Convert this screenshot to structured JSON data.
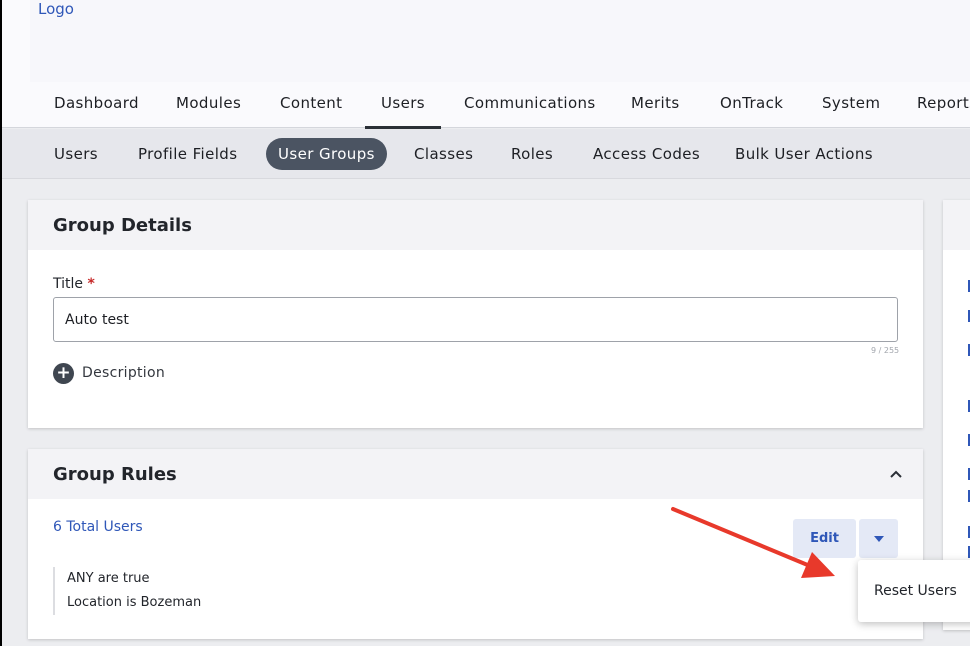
{
  "header": {
    "logo": "Logo"
  },
  "main_nav": {
    "items": [
      {
        "label": "Dashboard"
      },
      {
        "label": "Modules"
      },
      {
        "label": "Content"
      },
      {
        "label": "Users",
        "active": true
      },
      {
        "label": "Communications"
      },
      {
        "label": "Merits"
      },
      {
        "label": "OnTrack"
      },
      {
        "label": "System"
      },
      {
        "label": "Reports"
      }
    ]
  },
  "sub_nav": {
    "items": [
      {
        "label": "Users"
      },
      {
        "label": "Profile Fields"
      },
      {
        "label": "User Groups",
        "active": true
      },
      {
        "label": "Classes"
      },
      {
        "label": "Roles"
      },
      {
        "label": "Access Codes"
      },
      {
        "label": "Bulk User Actions"
      }
    ]
  },
  "group_details": {
    "heading": "Group Details",
    "title_label": "Title",
    "required_mark": "*",
    "title_value": "Auto test",
    "char_counter": "9 / 255",
    "description_label": "Description"
  },
  "group_rules": {
    "heading": "Group Rules",
    "total_users": "6 Total Users",
    "edit_label": "Edit",
    "rules": [
      "ANY are true",
      "Location is Bozeman"
    ],
    "dropdown": {
      "reset_users_label": "Reset Users"
    }
  },
  "colors": {
    "accent_blue": "#2f57b8",
    "active_pill": "#4b5462",
    "annotation_arrow": "#e8392b"
  },
  "icons": {
    "collapse": "chevron-up-icon",
    "split_toggle": "caret-down-icon",
    "add_description": "plus-circle-icon"
  }
}
